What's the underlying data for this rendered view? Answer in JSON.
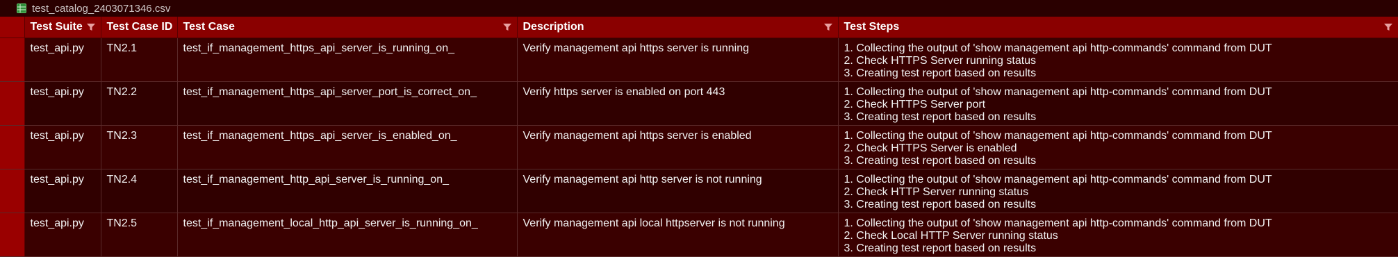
{
  "window": {
    "title": "test_catalog_2403071346.csv",
    "file_icon": "spreadsheet-icon"
  },
  "colors": {
    "header_bg": "#8a0000",
    "row_bg": "#3a0000",
    "row_alt_bg": "#300000",
    "row_header_bg": "#9a0000"
  },
  "table": {
    "columns": [
      {
        "label": "Test Suite"
      },
      {
        "label": "Test Case ID"
      },
      {
        "label": "Test Case"
      },
      {
        "label": "Description"
      },
      {
        "label": "Test Steps"
      }
    ],
    "rows": [
      {
        "suite": "test_api.py",
        "id": "TN2.1",
        "case": "test_if_management_https_api_server_is_running_on_",
        "description": "Verify management api https server is running",
        "steps": [
          "1. Collecting the output of 'show management api http-commands' command from DUT",
          "2. Check HTTPS Server running status",
          "3. Creating test report based on results"
        ]
      },
      {
        "suite": "test_api.py",
        "id": "TN2.2",
        "case": "test_if_management_https_api_server_port_is_correct_on_",
        "description": "Verify https server is enabled on port 443",
        "steps": [
          "1. Collecting the output of 'show management api http-commands' command from DUT",
          "2. Check HTTPS Server port",
          "3. Creating test report based on results"
        ]
      },
      {
        "suite": "test_api.py",
        "id": "TN2.3",
        "case": "test_if_management_https_api_server_is_enabled_on_",
        "description": "Verify management api https server is enabled",
        "steps": [
          "1. Collecting the output of 'show management api http-commands' command from DUT",
          "2. Check HTTPS Server is enabled",
          "3. Creating test report based on results"
        ]
      },
      {
        "suite": "test_api.py",
        "id": "TN2.4",
        "case": "test_if_management_http_api_server_is_running_on_",
        "description": "Verify management api http server is not running",
        "steps": [
          "1. Collecting the output of 'show management api http-commands' command from DUT",
          "2. Check HTTP Server running status",
          "3. Creating test report based on results"
        ]
      },
      {
        "suite": "test_api.py",
        "id": "TN2.5",
        "case": "test_if_management_local_http_api_server_is_running_on_",
        "description": "Verify management api local httpserver is not running",
        "steps": [
          "1. Collecting the output of 'show management api http-commands' command from DUT",
          "2. Check Local HTTP Server running status",
          "3. Creating test report based on results"
        ]
      }
    ]
  }
}
